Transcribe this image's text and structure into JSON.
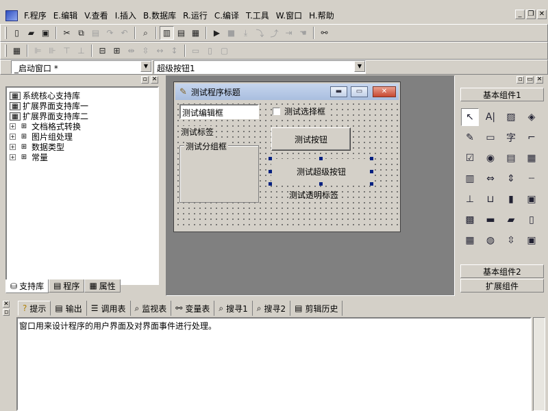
{
  "menu": [
    "F.程序",
    "E.编辑",
    "V.查看",
    "I.插入",
    "B.数据库",
    "R.运行",
    "C.编译",
    "T.工具",
    "W.窗口",
    "H.帮助"
  ],
  "window_combo": "_启动窗口 *",
  "component_combo": "超级按钮1",
  "support_tree": [
    {
      "label": "系统核心支持库",
      "expander": ""
    },
    {
      "label": "扩展界面支持库一",
      "expander": ""
    },
    {
      "label": "扩展界面支持库二",
      "expander": ""
    },
    {
      "label": "文档格式转换",
      "expander": "+"
    },
    {
      "label": "图片组处理",
      "expander": "+"
    },
    {
      "label": "数据类型",
      "expander": "+"
    },
    {
      "label": "常量",
      "expander": "+"
    }
  ],
  "left_tabs": [
    "支持库",
    "程序",
    "属性"
  ],
  "form": {
    "title": "测试程序标题",
    "edit_box": "测试编辑框",
    "checkbox": "测试选择框",
    "label": "测试标签",
    "button": "测试按钮",
    "group_box": "测试分组框",
    "super_button": "测试超级按钮",
    "transparent_label": "测试透明标签"
  },
  "palette": {
    "basic1": "基本组件1",
    "basic2": "基本组件2",
    "extended": "扩展组件",
    "items": [
      {
        "name": "pointer-tool-icon",
        "glyph": "↖"
      },
      {
        "name": "label-tool-icon",
        "glyph": "A|"
      },
      {
        "name": "picture-tool-icon",
        "glyph": "▨"
      },
      {
        "name": "shape-tool-icon",
        "glyph": "◈"
      },
      {
        "name": "edit-tool-icon",
        "glyph": "✎"
      },
      {
        "name": "button-tool-icon",
        "glyph": "▭"
      },
      {
        "name": "text-tool-icon",
        "glyph": "字"
      },
      {
        "name": "line-tool-icon",
        "glyph": "⌐"
      },
      {
        "name": "checkbox-tool-icon",
        "glyph": "☑"
      },
      {
        "name": "radio-tool-icon",
        "glyph": "◉"
      },
      {
        "name": "listbox-tool-icon",
        "glyph": "▤"
      },
      {
        "name": "combobox-tool-icon",
        "glyph": "▦"
      },
      {
        "name": "list-tool-icon",
        "glyph": "▥"
      },
      {
        "name": "scrollbar-h-tool-icon",
        "glyph": "⇔"
      },
      {
        "name": "scrollbar-v-tool-icon",
        "glyph": "⇕"
      },
      {
        "name": "separator-tool-icon",
        "glyph": "┈"
      },
      {
        "name": "ruler-tool-icon",
        "glyph": "⊥"
      },
      {
        "name": "bracket-tool-icon",
        "glyph": "⊔"
      },
      {
        "name": "bar-tool-icon",
        "glyph": "▮"
      },
      {
        "name": "image-box-tool-icon",
        "glyph": "▣"
      },
      {
        "name": "calendar-tool-icon",
        "glyph": "▩"
      },
      {
        "name": "input-tool-icon",
        "glyph": "▬"
      },
      {
        "name": "folder-tool-icon",
        "glyph": "▰"
      },
      {
        "name": "file-tool-icon",
        "glyph": "▯"
      },
      {
        "name": "grid-tool-icon",
        "glyph": "▦"
      },
      {
        "name": "globe-tool-icon",
        "glyph": "◍"
      },
      {
        "name": "spinner-tool-icon",
        "glyph": "⇳"
      },
      {
        "name": "media-tool-icon",
        "glyph": "▣"
      }
    ]
  },
  "bottom_tabs": [
    "提示",
    "输出",
    "调用表",
    "监视表",
    "变量表",
    "搜寻1",
    "搜寻2",
    "剪辑历史"
  ],
  "output_text": "窗口用来设计程序的用户界面及对界面事件进行处理。"
}
